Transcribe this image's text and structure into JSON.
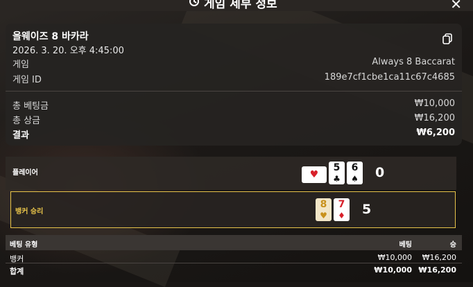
{
  "header": {
    "title": "게임 세부 정보"
  },
  "summary": {
    "game_name": "올웨이즈 8 바카라",
    "datetime": "2026. 3. 20. 오후 4:45:00",
    "game_label": "게임",
    "game_value": "Always 8 Baccarat",
    "game_id_label": "게임 ID",
    "game_id_value": "189e7cf1cbe1ca11c67c4685",
    "total_bet_label": "총 베팅금",
    "total_bet_value": "₩10,000",
    "total_win_label": "총 상금",
    "total_win_value": "₩16,200",
    "result_label": "결과",
    "result_value": "₩6,200"
  },
  "player": {
    "label": "플레이어",
    "cards": [
      {
        "rank": "",
        "suit": "♥",
        "color": "red",
        "hidden": true
      },
      {
        "rank": "5",
        "suit": "♣",
        "color": "black"
      },
      {
        "rank": "6",
        "suit": "♠",
        "color": "black"
      }
    ],
    "score": "0"
  },
  "banker": {
    "label": "뱅커 승리",
    "label_color": "#e8c44a",
    "cards": [
      {
        "rank": "8",
        "suit": "♥",
        "color": "gold"
      },
      {
        "rank": "7",
        "suit": "♦",
        "color": "red"
      }
    ],
    "score": "5"
  },
  "bets_table": {
    "headers": [
      "베팅 유형",
      "베팅",
      "승"
    ],
    "rows": [
      [
        "뱅커",
        "₩10,000",
        "₩16,200"
      ],
      [
        "합계",
        "₩10,000",
        "₩16,200"
      ]
    ]
  },
  "colors": {
    "accent": "#e8c44a",
    "card_red": "#d8202a"
  }
}
